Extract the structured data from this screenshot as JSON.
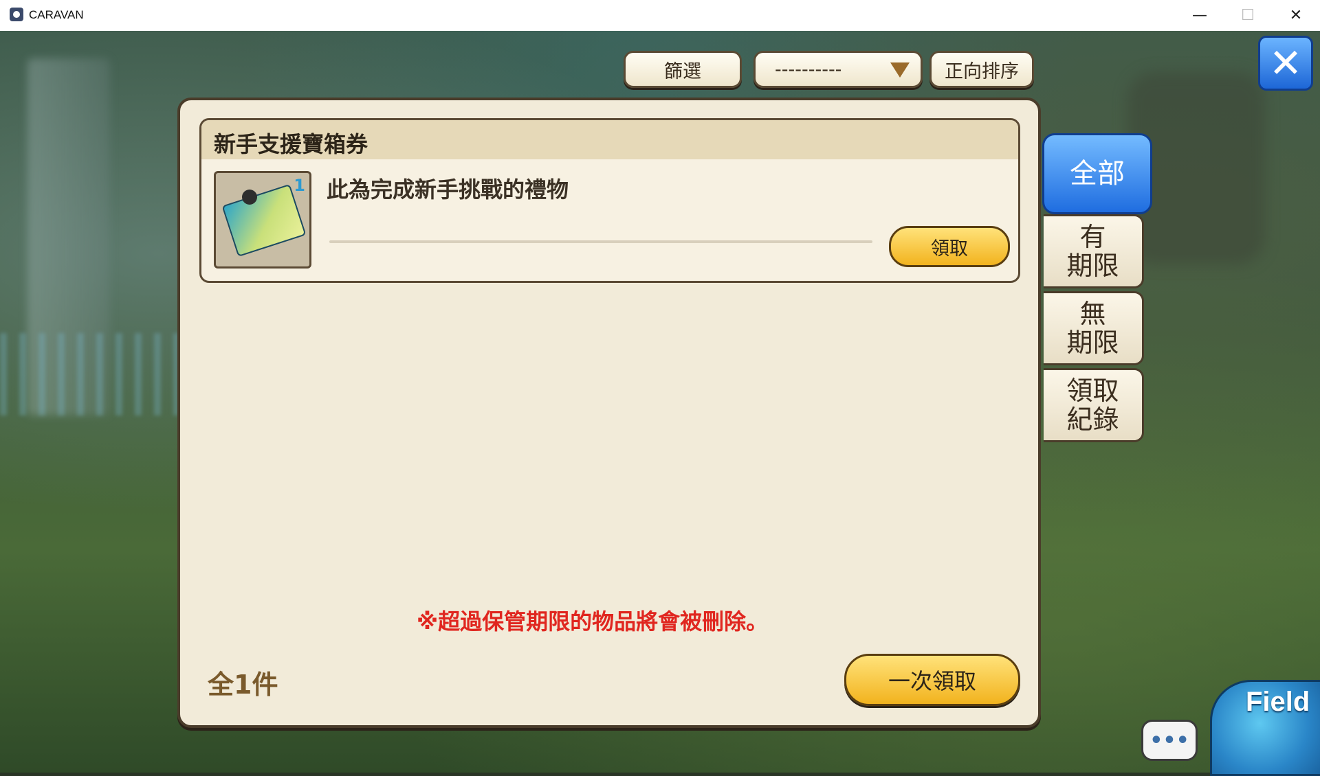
{
  "window": {
    "title": "CARAVAN",
    "min_glyph": "—",
    "max_glyph": "☐",
    "close_glyph": "✕"
  },
  "toolbar": {
    "filter_label": "篩選",
    "dropdown_value": "----------",
    "sort_label": "正向排序",
    "close_glyph": "✕"
  },
  "tabs": [
    {
      "label": "全部",
      "active": true
    },
    {
      "label": "有\n期限",
      "active": false
    },
    {
      "label": "無\n期限",
      "active": false
    },
    {
      "label": "領取\n紀錄",
      "active": false
    }
  ],
  "items": [
    {
      "title": "新手支援寶箱券",
      "description": "此為完成新手挑戰的禮物",
      "count": "1",
      "claim_label": "領取"
    }
  ],
  "footer": {
    "warning": "※超過保管期限的物品將會被刪除。",
    "total": "全1件",
    "claim_all_label": "一次領取"
  },
  "hud": {
    "chat_glyph": "•••",
    "field_label": "Field"
  },
  "colors": {
    "panel_bg": "#f2ebd9",
    "panel_border": "#4a3c2a",
    "accent_blue": "#1f6de0",
    "button_gold": "#f2b31e",
    "warning_red": "#e0261f"
  }
}
